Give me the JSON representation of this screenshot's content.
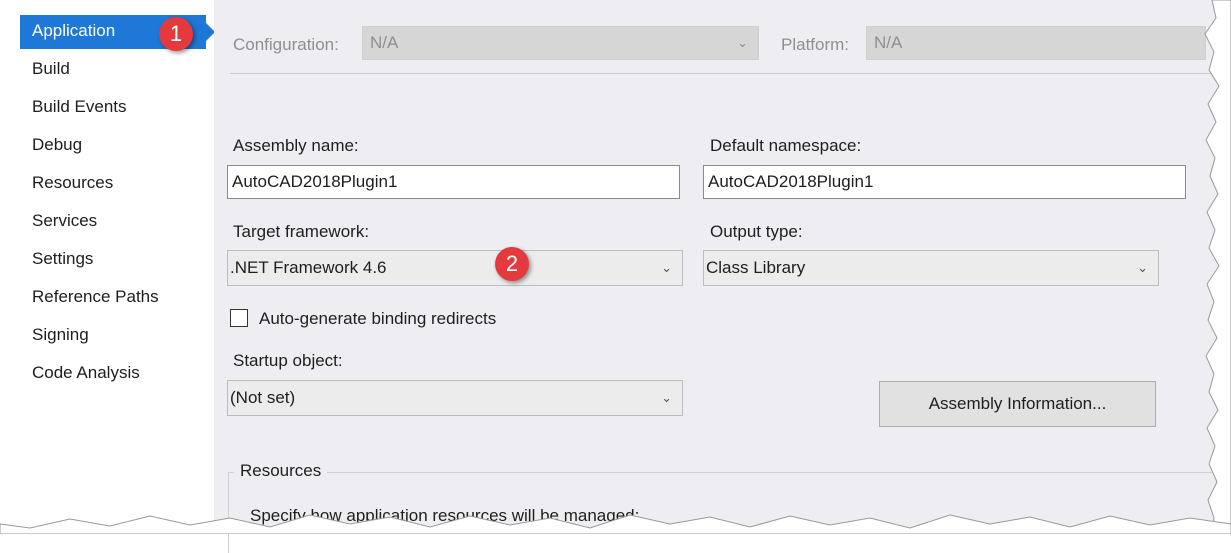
{
  "sidebar": {
    "items": [
      {
        "label": "Application",
        "selected": true
      },
      {
        "label": "Build"
      },
      {
        "label": "Build Events"
      },
      {
        "label": "Debug"
      },
      {
        "label": "Resources"
      },
      {
        "label": "Services"
      },
      {
        "label": "Settings"
      },
      {
        "label": "Reference Paths"
      },
      {
        "label": "Signing"
      },
      {
        "label": "Code Analysis"
      }
    ]
  },
  "toolbar": {
    "configuration_label": "Configuration:",
    "configuration_value": "N/A",
    "platform_label": "Platform:",
    "platform_value": "N/A"
  },
  "form": {
    "assembly_name_label": "Assembly name:",
    "assembly_name_value": "AutoCAD2018Plugin1",
    "default_namespace_label": "Default namespace:",
    "default_namespace_value": "AutoCAD2018Plugin1",
    "target_framework_label": "Target framework:",
    "target_framework_value": ".NET Framework 4.6",
    "output_type_label": "Output type:",
    "output_type_value": "Class Library",
    "binding_redirects_label": "Auto-generate binding redirects",
    "binding_redirects_checked": false,
    "startup_object_label": "Startup object:",
    "startup_object_value": "(Not set)",
    "assembly_info_button": "Assembly Information..."
  },
  "resources": {
    "title": "Resources",
    "description": "Specify how application resources will be managed:"
  },
  "annotations": {
    "badge1": "1",
    "badge2": "2",
    "color": "#e43a3e"
  },
  "colors": {
    "accent": "#1e78d7",
    "panel_bg": "#eeeef2"
  },
  "icons": {
    "dropdown": "chevron-down-icon",
    "checkbox": "checkbox-unchecked-icon"
  }
}
